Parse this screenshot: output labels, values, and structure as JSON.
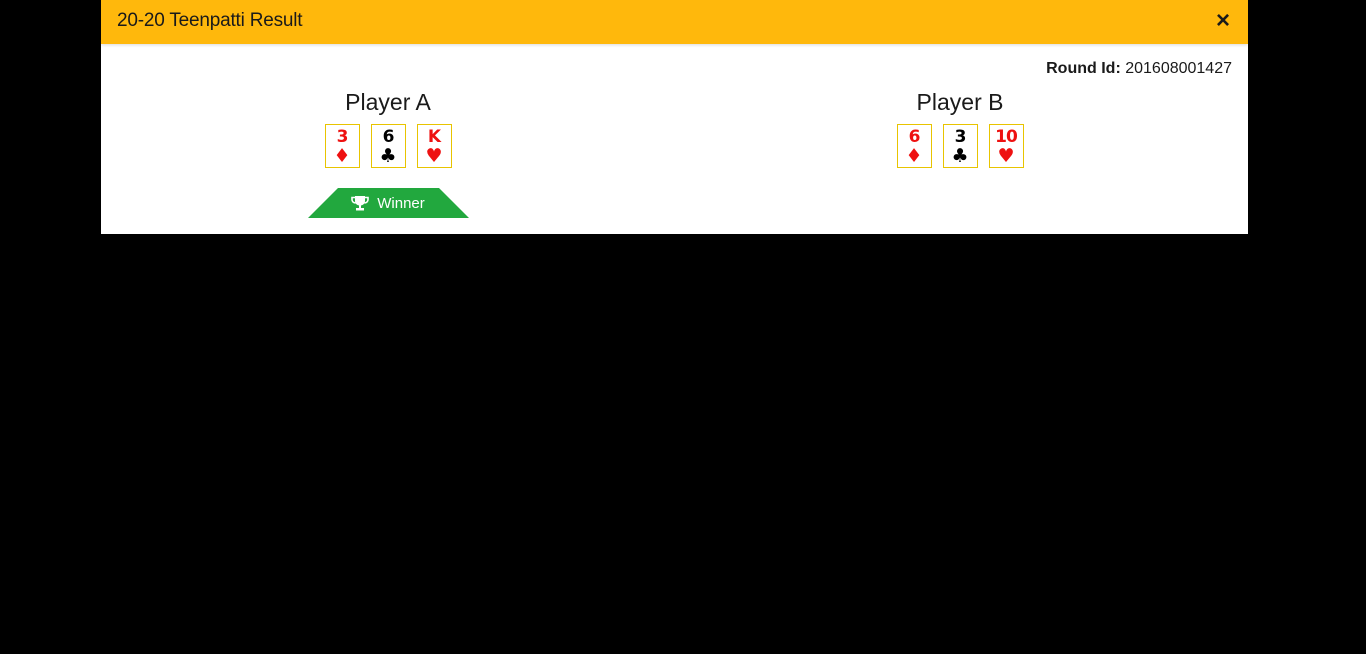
{
  "modal": {
    "title": "20-20 Teenpatti Result",
    "close_label": "×"
  },
  "round": {
    "label": "Round Id:",
    "value": "201608001427"
  },
  "players": [
    {
      "name": "Player A",
      "cards": [
        {
          "rank": "3",
          "suit": "♦",
          "suit_name": "diamond",
          "color": "#ee1111"
        },
        {
          "rank": "6",
          "suit": "♣",
          "suit_name": "club",
          "color": "#000000"
        },
        {
          "rank": "K",
          "suit": "♥",
          "suit_name": "heart",
          "color": "#ee1111"
        }
      ],
      "winner": true
    },
    {
      "name": "Player B",
      "cards": [
        {
          "rank": "6",
          "suit": "♦",
          "suit_name": "diamond",
          "color": "#ee1111"
        },
        {
          "rank": "3",
          "suit": "♣",
          "suit_name": "club",
          "color": "#000000"
        },
        {
          "rank": "10",
          "suit": "♥",
          "suit_name": "heart",
          "color": "#ee1111"
        }
      ],
      "winner": false
    }
  ],
  "winner_badge": {
    "label": "Winner",
    "icon": "trophy-icon",
    "color": "#22a83e"
  },
  "colors": {
    "header": "#ffb80c",
    "backdrop": "#000000",
    "card_border": "#e8c400"
  }
}
